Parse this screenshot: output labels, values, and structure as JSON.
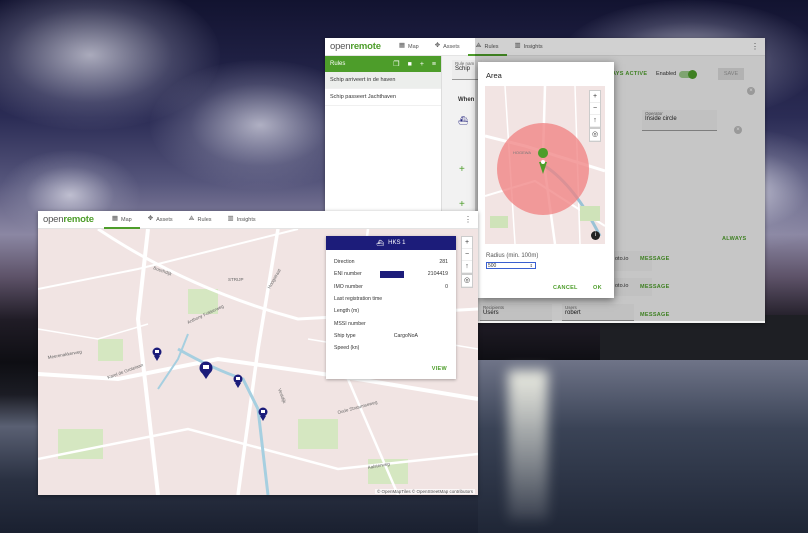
{
  "rules_window": {
    "logo_prefix": "open",
    "logo_suffix": "remote",
    "tabs": [
      {
        "label": "Map",
        "icon": "map-icon",
        "active": false
      },
      {
        "label": "Assets",
        "icon": "assets-icon",
        "active": false
      },
      {
        "label": "Rules",
        "icon": "rules-icon",
        "active": true
      },
      {
        "label": "Insights",
        "icon": "insights-icon",
        "active": false
      }
    ],
    "rules_header": "Rules",
    "rules": [
      "Schip arriveert in de haven",
      "Schip passeert Jachthaven"
    ],
    "rule_name_label": "Rule nam",
    "rule_name_value": "Schip",
    "always_active_label": "AYS ACTIVE",
    "enabled_label": "Enabled",
    "save_label": "SAVE",
    "when_label": "When",
    "operator_label": "Operator",
    "operator_value": "Inside circle",
    "always_label": "ALWAYS",
    "action_partial_1": "oto.io",
    "action_partial_2": "oto.io",
    "message_label": "MESSAGE",
    "recipients_label": "Recipients",
    "recipients_value": "Users",
    "users_label": "Users",
    "users_value": "robert"
  },
  "dialog": {
    "title": "Area",
    "street_label": "HOGEWA",
    "radius_label": "Radius (min. 100m)",
    "radius_value": "500",
    "cancel_label": "CANCEL",
    "ok_label": "OK"
  },
  "map_window": {
    "logo_prefix": "open",
    "logo_suffix": "remote",
    "tabs": [
      {
        "label": "Map",
        "icon": "map-icon",
        "active": true
      },
      {
        "label": "Assets",
        "icon": "assets-icon",
        "active": false
      },
      {
        "label": "Rules",
        "icon": "rules-icon",
        "active": false
      },
      {
        "label": "Insights",
        "icon": "insights-icon",
        "active": false
      }
    ],
    "street_labels": [
      "STRIJP",
      "Meerenakkerweg",
      "Anthony Fokkerweg",
      "Hoogstraat",
      "Vestdijk",
      "Boschdijk",
      "Karel de Grotelaan",
      "Oude Stratumseweg",
      "Aalsterweg"
    ],
    "attribution": "© OpenMapTiles © OpenStreetMap contributors"
  },
  "info_card": {
    "title": "HKS 1",
    "rows": [
      {
        "label": "Direction",
        "value": "281"
      },
      {
        "label": "ENI number",
        "value": "2104419"
      },
      {
        "label": "IMO number",
        "value": "0"
      },
      {
        "label": "Last registration time",
        "value": ""
      },
      {
        "label": "Length (m)",
        "value": ""
      },
      {
        "label": "MSSI number",
        "value": ""
      },
      {
        "label": "Ship type",
        "value": "CargoNoA"
      },
      {
        "label": "Speed (kn)",
        "value": ""
      }
    ],
    "view_label": "VIEW"
  },
  "colors": {
    "accent": "#4d9d2a",
    "ship": "#1c1c7a",
    "circle": "#f08080"
  }
}
